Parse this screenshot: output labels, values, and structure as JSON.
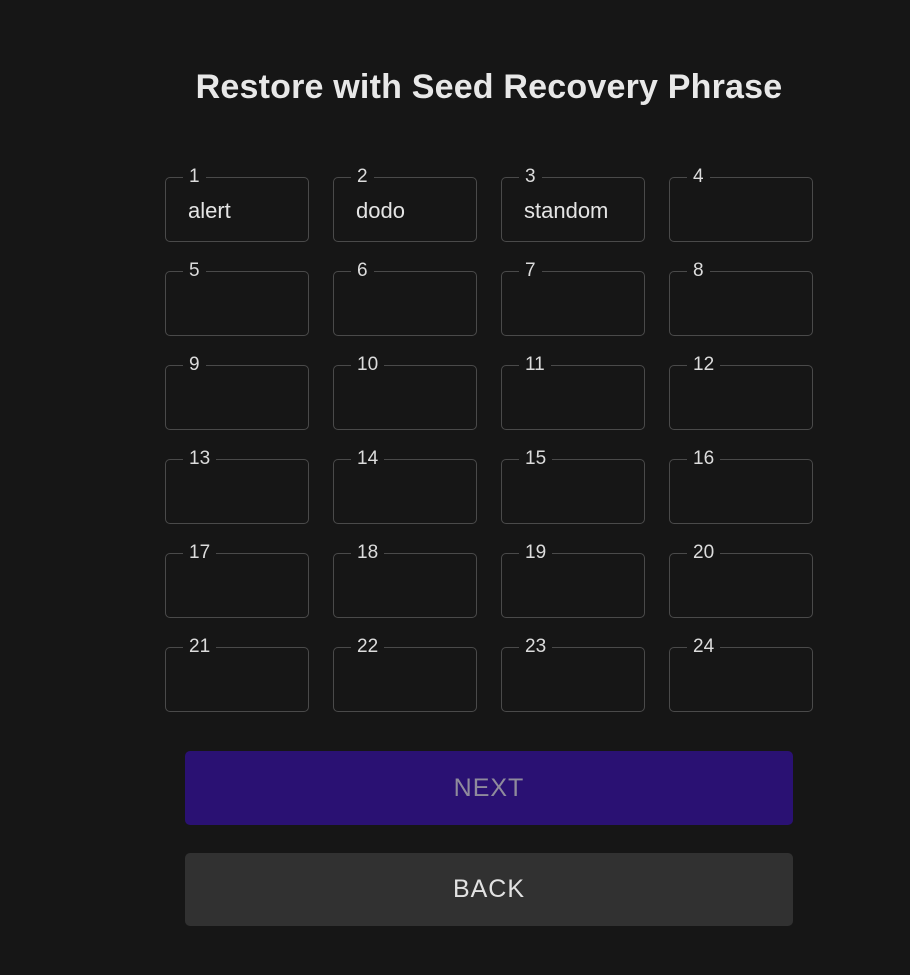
{
  "title": "Restore with Seed Recovery Phrase",
  "words": [
    {
      "label": "1",
      "value": "alert"
    },
    {
      "label": "2",
      "value": "dodo"
    },
    {
      "label": "3",
      "value": "standom"
    },
    {
      "label": "4",
      "value": ""
    },
    {
      "label": "5",
      "value": ""
    },
    {
      "label": "6",
      "value": ""
    },
    {
      "label": "7",
      "value": ""
    },
    {
      "label": "8",
      "value": ""
    },
    {
      "label": "9",
      "value": ""
    },
    {
      "label": "10",
      "value": ""
    },
    {
      "label": "11",
      "value": ""
    },
    {
      "label": "12",
      "value": ""
    },
    {
      "label": "13",
      "value": ""
    },
    {
      "label": "14",
      "value": ""
    },
    {
      "label": "15",
      "value": ""
    },
    {
      "label": "16",
      "value": ""
    },
    {
      "label": "17",
      "value": ""
    },
    {
      "label": "18",
      "value": ""
    },
    {
      "label": "19",
      "value": ""
    },
    {
      "label": "20",
      "value": ""
    },
    {
      "label": "21",
      "value": ""
    },
    {
      "label": "22",
      "value": ""
    },
    {
      "label": "23",
      "value": ""
    },
    {
      "label": "24",
      "value": ""
    }
  ],
  "buttons": {
    "next_label": "NEXT",
    "back_label": "BACK"
  },
  "colors": {
    "background": "#161616",
    "next_button": "#2a1173",
    "back_button": "#313131"
  }
}
